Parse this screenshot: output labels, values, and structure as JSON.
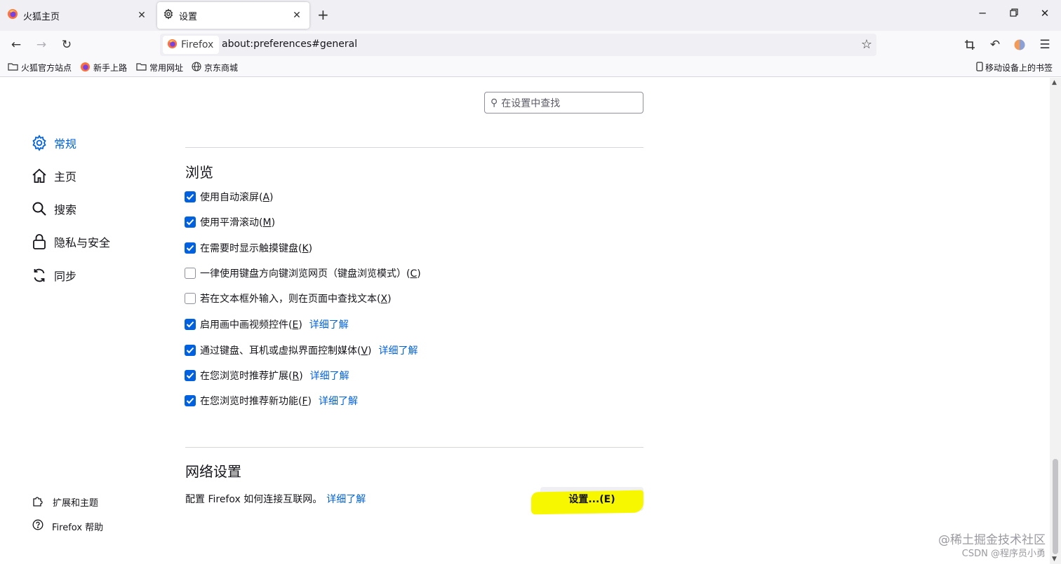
{
  "browser": {
    "tabs": [
      {
        "label": "火狐主页",
        "icon": "firefox-logo-icon"
      },
      {
        "label": "设置",
        "icon": "gear-icon"
      }
    ],
    "close_glyph": "✕",
    "new_tab_glyph": "+",
    "identity_label": "Firefox",
    "url": "about:preferences#general",
    "bookmarks": [
      {
        "label": "火狐官方站点",
        "icon": "folder-icon"
      },
      {
        "label": "新手上路",
        "icon": "firefox-logo-icon"
      },
      {
        "label": "常用网址",
        "icon": "folder-icon"
      },
      {
        "label": "京东商城",
        "icon": "globe-icon"
      }
    ],
    "mobile_bookmarks_label": "移动设备上的书签"
  },
  "search": {
    "placeholder": "在设置中查找"
  },
  "sidebar": {
    "categories": [
      {
        "label": "常规",
        "icon": "gear-icon",
        "active": true
      },
      {
        "label": "主页",
        "icon": "home-icon",
        "active": false
      },
      {
        "label": "搜索",
        "icon": "search-icon",
        "active": false
      },
      {
        "label": "隐私与安全",
        "icon": "lock-icon",
        "active": false
      },
      {
        "label": "同步",
        "icon": "sync-icon",
        "active": false
      }
    ],
    "footer": [
      {
        "label": "扩展和主题",
        "icon": "puzzle-icon"
      },
      {
        "label": "Firefox 帮助",
        "icon": "help-icon"
      }
    ]
  },
  "browsing": {
    "title": "浏览",
    "options": [
      {
        "label": "使用自动滚屏(",
        "key": "A",
        "suffix": ")",
        "checked": true,
        "learn_more": ""
      },
      {
        "label": "使用平滑滚动(",
        "key": "M",
        "suffix": ")",
        "checked": true,
        "learn_more": ""
      },
      {
        "label": "在需要时显示触摸键盘(",
        "key": "K",
        "suffix": ")",
        "checked": true,
        "learn_more": ""
      },
      {
        "label": "一律使用键盘方向键浏览网页（键盘浏览模式）(",
        "key": "C",
        "suffix": ")",
        "checked": false,
        "learn_more": ""
      },
      {
        "label": "若在文本框外输入，则在页面中查找文本(",
        "key": "X",
        "suffix": ")",
        "checked": false,
        "learn_more": ""
      },
      {
        "label": "启用画中画视频控件(",
        "key": "E",
        "suffix": ")",
        "checked": true,
        "learn_more": "详细了解"
      },
      {
        "label": "通过键盘、耳机或虚拟界面控制媒体(",
        "key": "V",
        "suffix": ")",
        "checked": true,
        "learn_more": "详细了解"
      },
      {
        "label": "在您浏览时推荐扩展(",
        "key": "R",
        "suffix": ")",
        "checked": true,
        "learn_more": "详细了解"
      },
      {
        "label": "在您浏览时推荐新功能(",
        "key": "F",
        "suffix": ")",
        "checked": true,
        "learn_more": "详细了解"
      }
    ]
  },
  "network": {
    "title": "网络设置",
    "description": "配置 Firefox 如何连接互联网。",
    "learn_more": "详细了解",
    "button_label": "设置...(E)"
  },
  "watermark": {
    "line1": "@稀土掘金技术社区",
    "line2": "CSDN @程序员小勇"
  },
  "colors": {
    "accent": "#0061e0",
    "highlight": "#f7f700",
    "tab_strip": "#f0f0f4"
  }
}
